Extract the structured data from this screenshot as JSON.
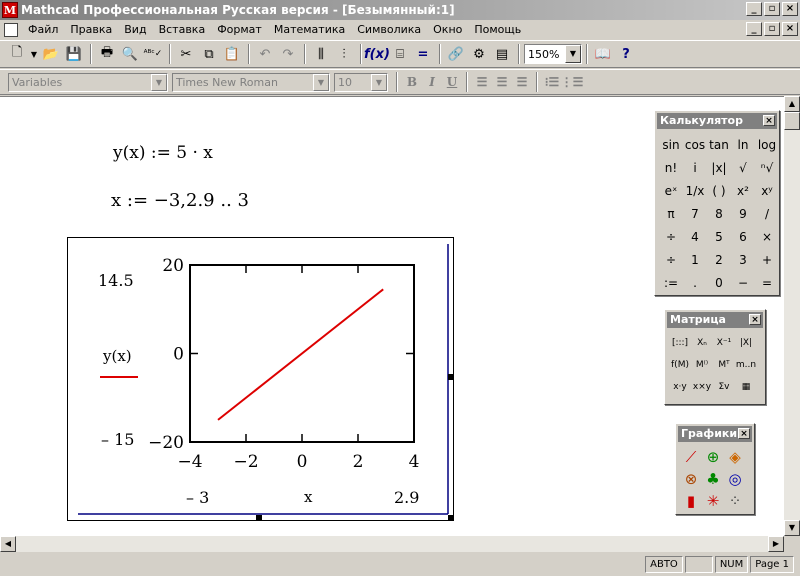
{
  "window": {
    "title": "Mathcad Профессиональная Русская версия - [Безымянный:1]",
    "min": "_",
    "max": "▫",
    "close": "×"
  },
  "menu": {
    "items": [
      "Файл",
      "Правка",
      "Вид",
      "Вставка",
      "Формат",
      "Математика",
      "Символика",
      "Окно",
      "Помощь"
    ]
  },
  "toolbar": {
    "zoom": "150%"
  },
  "format_bar": {
    "style": "Variables",
    "font": "Times New Roman",
    "size": "10",
    "bold": "B",
    "italic": "I",
    "underline": "U"
  },
  "worksheet": {
    "eq1": "y(x) := 5 · x",
    "eq2": "x := −3,2.9 .. 3"
  },
  "plot": {
    "y_upper": "14.5",
    "y_lower": "– 15",
    "x_left": "– 3",
    "x_right": "2.9",
    "trace_label": "y(x)",
    "x_label": "x",
    "trace_color": "#dd0000"
  },
  "chart_data": {
    "type": "line",
    "series": [
      {
        "name": "y(x)",
        "x": [
          -3,
          2.9
        ],
        "y": [
          -15,
          14.5
        ]
      }
    ],
    "xlim": [
      -4,
      4
    ],
    "ylim": [
      -20,
      20
    ],
    "xticks": [
      "−4",
      "−2",
      "0",
      "2",
      "4"
    ],
    "yticks": [
      "20",
      "0",
      "−20"
    ],
    "xlabel": "x",
    "ylabel": "y(x)"
  },
  "calculator": {
    "title": "Калькулятор",
    "buttons": [
      "sin",
      "cos",
      "tan",
      "ln",
      "log",
      "n!",
      "i",
      "|x|",
      "√",
      "ⁿ√",
      "eˣ",
      "1/x",
      "( )",
      "x²",
      "xʸ",
      "π",
      "7",
      "8",
      "9",
      "/",
      "÷",
      "4",
      "5",
      "6",
      "×",
      "÷",
      "1",
      "2",
      "3",
      "+",
      ":=",
      ".",
      "0",
      "−",
      "="
    ]
  },
  "matrix": {
    "title": "Матрица",
    "buttons": [
      "[:::]",
      "Xₙ",
      "X⁻¹",
      "|X|",
      "f(M)",
      "M⁽⁾",
      "Mᵀ",
      "m..n",
      "x·y",
      "x×y",
      "Σv",
      "▦"
    ]
  },
  "graphs": {
    "title": "Графики",
    "icons": [
      "xy-plot-icon",
      "polar-plot-icon",
      "surface-plot-icon",
      "contour-icon",
      "3d-scatter-icon",
      "vector-field-icon",
      "bar3d-icon",
      "scatter-icon",
      "patch-icon"
    ]
  },
  "status": {
    "mode": "АВТО",
    "num": "NUM",
    "page": "Page 1"
  }
}
